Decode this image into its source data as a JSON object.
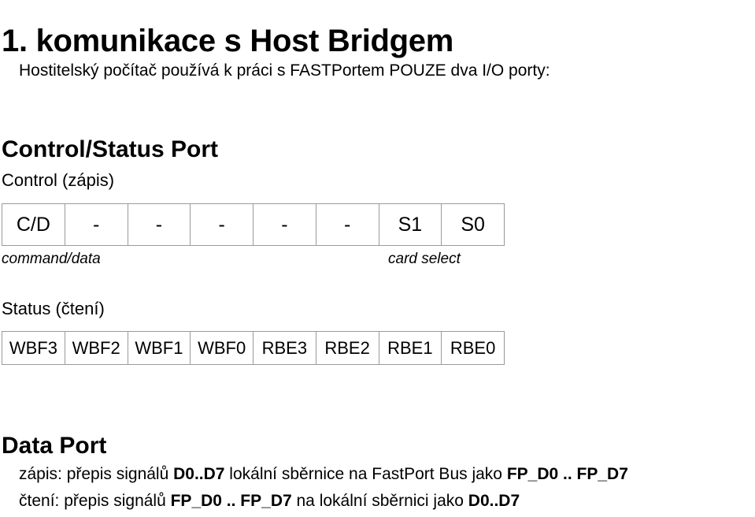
{
  "slide": {
    "title": "1. komunikace s Host Bridgem",
    "subtitle": "Hostitelský počítač používá k práci s FASTPortem POUZE dva I/O porty:",
    "control_status_port": {
      "heading": "Control/Status Port",
      "control": {
        "sub_heading": "Control (zápis)",
        "bits": [
          "C/D",
          "-",
          "-",
          "-",
          "-",
          "-",
          "S1",
          "S0"
        ],
        "annotation_left": "command/data",
        "annotation_right": "card select"
      },
      "status": {
        "sub_heading": "Status (čtení)",
        "bits": [
          "WBF3",
          "WBF2",
          "WBF1",
          "WBF0",
          "RBE3",
          "RBE2",
          "RBE1",
          "RBE0"
        ]
      }
    },
    "data_port": {
      "heading": "Data Port",
      "lines": [
        {
          "segments": [
            {
              "text": "zápis: přepis signálů ",
              "bold": false
            },
            {
              "text": "D0..D7",
              "bold": true
            },
            {
              "text": " lokální sběrnice na FastPort Bus jako ",
              "bold": false
            },
            {
              "text": "FP_D0 .. FP_D7",
              "bold": true
            }
          ]
        },
        {
          "segments": [
            {
              "text": "čtení: přepis signálů ",
              "bold": false
            },
            {
              "text": "FP_D0 .. FP_D7",
              "bold": true
            },
            {
              "text": " na lokální sběrnici jako ",
              "bold": false
            },
            {
              "text": "D0..D7",
              "bold": true
            }
          ]
        }
      ]
    },
    "colors": {
      "background": "#ffffff",
      "text": "#000000",
      "table_border": "#9a9a9a"
    }
  }
}
